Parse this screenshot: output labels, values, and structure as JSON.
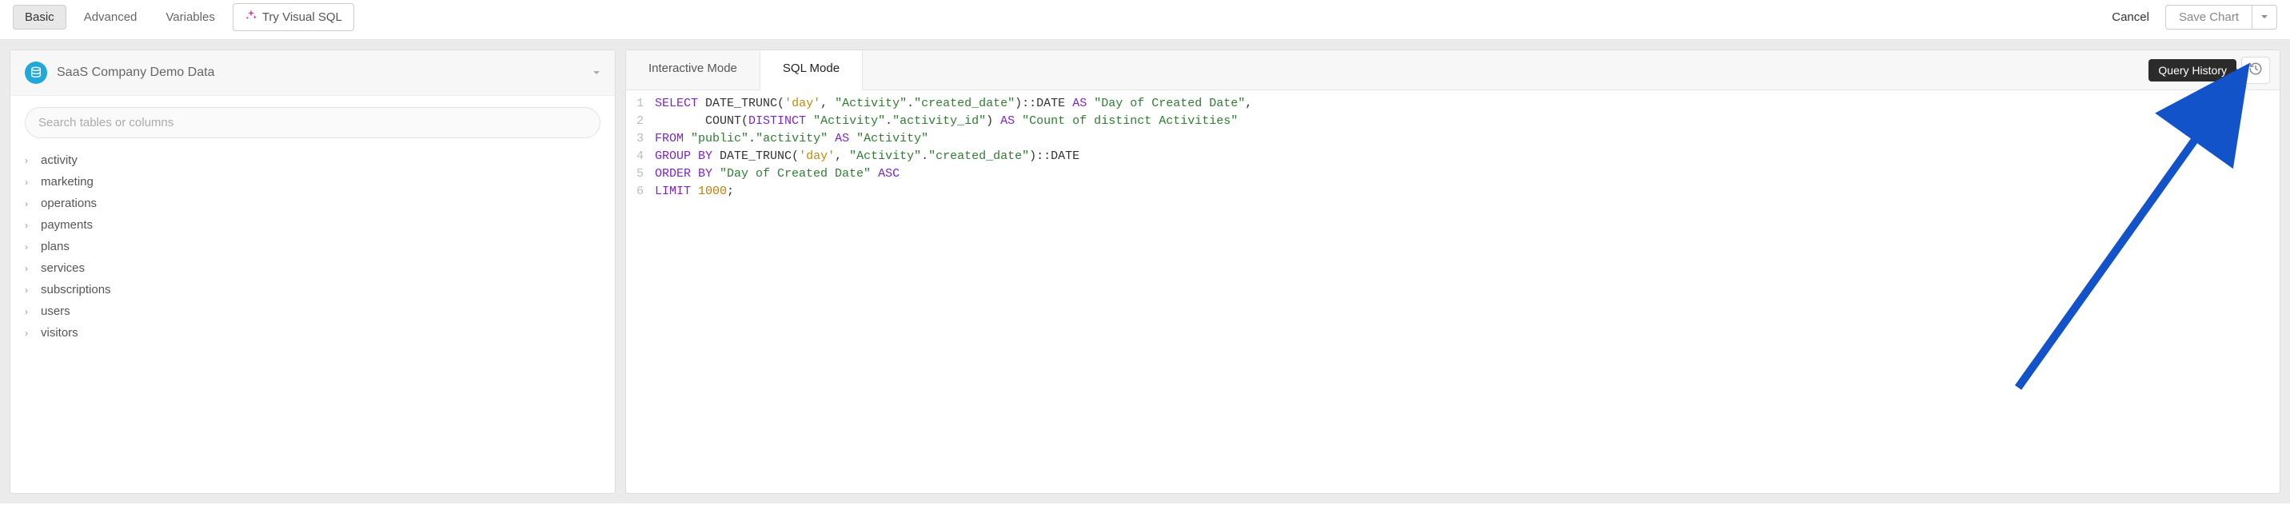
{
  "topbar": {
    "basic": "Basic",
    "advanced": "Advanced",
    "variables": "Variables",
    "try_visual": "Try Visual SQL",
    "cancel": "Cancel",
    "save_chart": "Save Chart"
  },
  "sidebar": {
    "datasource": "SaaS Company Demo Data",
    "search_placeholder": "Search tables or columns",
    "tables": [
      "activity",
      "marketing",
      "operations",
      "payments",
      "plans",
      "services",
      "subscriptions",
      "users",
      "visitors"
    ]
  },
  "editor": {
    "tabs": {
      "interactive": "Interactive Mode",
      "sql": "SQL Mode"
    },
    "tooltip": "Query History",
    "lines": [
      "1",
      "2",
      "3",
      "4",
      "5",
      "6"
    ],
    "code": {
      "l1_kw1": "SELECT",
      "l1_fn": "DATE_TRUNC",
      "l1_p1": "(",
      "l1_s1": "'day'",
      "l1_c1": ", ",
      "l1_id1": "\"Activity\"",
      "l1_d1": ".",
      "l1_id2": "\"created_date\"",
      "l1_p2": ")::",
      "l1_ty": "DATE",
      "l1_as": " AS ",
      "l1_al": "\"Day of Created Date\"",
      "l1_end": ",",
      "l2_pad": "       ",
      "l2_fn": "COUNT",
      "l2_p1": "(",
      "l2_kw": "DISTINCT",
      "l2_sp": " ",
      "l2_id1": "\"Activity\"",
      "l2_d1": ".",
      "l2_id2": "\"activity_id\"",
      "l2_p2": ")",
      "l2_as": " AS ",
      "l2_al": "\"Count of distinct Activities\"",
      "l3_kw": "FROM",
      "l3_sp": " ",
      "l3_id1": "\"public\"",
      "l3_d1": ".",
      "l3_id2": "\"activity\"",
      "l3_as": " AS ",
      "l3_al": "\"Activity\"",
      "l4_kw": "GROUP BY",
      "l4_sp": " ",
      "l4_fn": "DATE_TRUNC",
      "l4_p1": "(",
      "l4_s1": "'day'",
      "l4_c1": ", ",
      "l4_id1": "\"Activity\"",
      "l4_d1": ".",
      "l4_id2": "\"created_date\"",
      "l4_p2": ")::",
      "l4_ty": "DATE",
      "l5_kw": "ORDER BY",
      "l5_sp": " ",
      "l5_id": "\"Day of Created Date\"",
      "l5_dir": " ASC",
      "l6_kw": "LIMIT",
      "l6_sp": " ",
      "l6_n": "1000",
      "l6_end": ";"
    }
  }
}
